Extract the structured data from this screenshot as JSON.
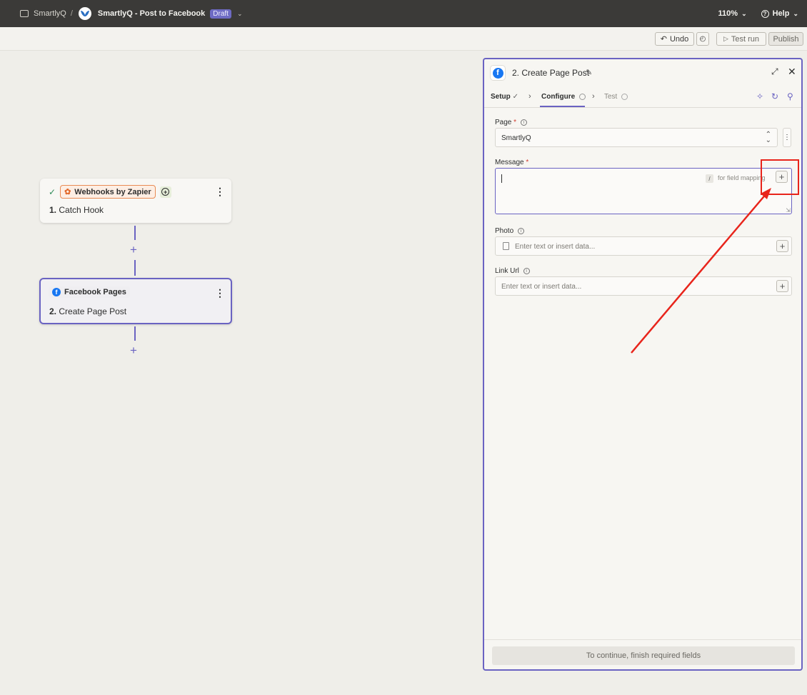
{
  "topbar": {
    "breadcrumb_folder": "SmartlyQ",
    "separator": "/",
    "zap_title": "SmartlyQ - Post to Facebook",
    "status_badge": "Draft",
    "zoom": "110%",
    "help": "Help"
  },
  "toolbar": {
    "undo": "Undo",
    "test_run": "Test run",
    "publish": "Publish"
  },
  "canvas": {
    "steps": [
      {
        "app": "Webhooks by Zapier",
        "number": "1.",
        "title": "Catch Hook",
        "status": "complete"
      },
      {
        "app": "Facebook Pages",
        "number": "2.",
        "title": "Create Page Post",
        "status": "selected"
      }
    ]
  },
  "panel": {
    "title": "2. Create Page Post",
    "tabs": [
      {
        "label": "Setup",
        "state": "done"
      },
      {
        "label": "Configure",
        "state": "active"
      },
      {
        "label": "Test",
        "state": "disabled"
      }
    ],
    "fields": {
      "page": {
        "label": "Page",
        "required_mark": "*",
        "value": "SmartlyQ"
      },
      "message": {
        "label": "Message",
        "required_mark": "*",
        "value": "",
        "slash_key": "/",
        "hint": "for field mapping"
      },
      "photo": {
        "label": "Photo",
        "placeholder": "Enter text or insert data..."
      },
      "link_url": {
        "label": "Link Url",
        "placeholder": "Enter text or insert data..."
      }
    },
    "footer_button": "To continue, finish required fields"
  },
  "colors": {
    "accent": "#6a63c2",
    "topbar_bg": "#3b3a38",
    "annotation_red": "#e8241b",
    "facebook_blue": "#1877f2"
  }
}
